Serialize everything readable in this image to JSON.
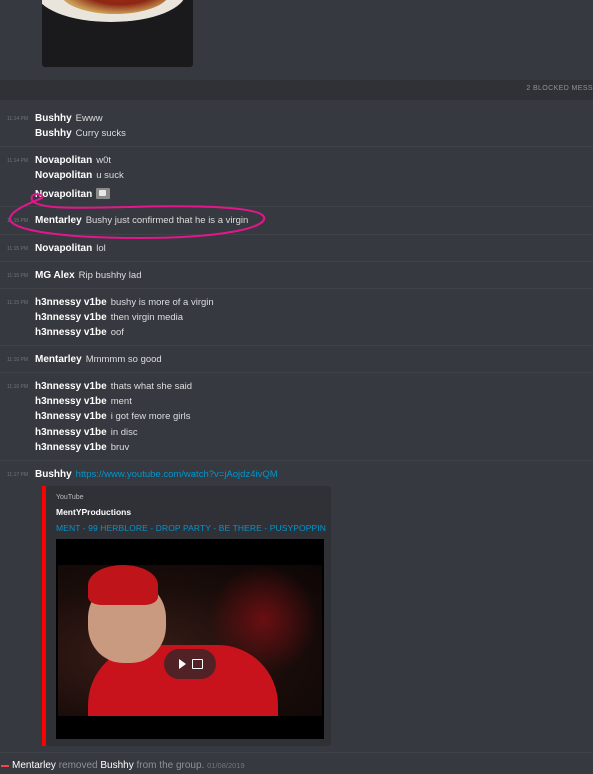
{
  "blocked_notice": "2 BLOCKED MESS",
  "messages": [
    {
      "time": "11:14 PM",
      "author": "Bushhy",
      "text": "Ewww"
    },
    {
      "time": "",
      "author": "Bushhy",
      "text": "Curry sucks"
    },
    {
      "time": "11:14 PM",
      "author": "Novapolitan",
      "text": "w0t"
    },
    {
      "time": "",
      "author": "Novapolitan",
      "text": "u suck"
    },
    {
      "time": "",
      "author": "Novapolitan",
      "text": ""
    },
    {
      "time": "11:15 PM",
      "author": "Mentarley",
      "text": "Bushy just confirmed that he is a virgin"
    },
    {
      "time": "11:15 PM",
      "author": "Novapolitan",
      "text": "lol"
    },
    {
      "time": "11:15 PM",
      "author": "MG Alex",
      "text": "Rip bushhy lad"
    },
    {
      "time": "11:15 PM",
      "author": "h3nnessy v1be",
      "text": "bushy is more of a virgin"
    },
    {
      "time": "",
      "author": "h3nnessy v1be",
      "text": "then virgin media"
    },
    {
      "time": "",
      "author": "h3nnessy v1be",
      "text": "oof"
    },
    {
      "time": "11:16 PM",
      "author": "Mentarley",
      "text": "Mmmmm so good"
    },
    {
      "time": "11:16 PM",
      "author": "h3nnessy v1be",
      "text": "thats what she said"
    },
    {
      "time": "",
      "author": "h3nnessy v1be",
      "text": "ment"
    },
    {
      "time": "",
      "author": "h3nnessy v1be",
      "text": "i got few more girls"
    },
    {
      "time": "",
      "author": "h3nnessy v1be",
      "text": "in disc"
    },
    {
      "time": "",
      "author": "h3nnessy v1be",
      "text": "bruv"
    },
    {
      "time": "11:17 PM",
      "author": "Bushhy",
      "link": "https://www.youtube.com/watch?v=jAojdz4ivQM"
    }
  ],
  "embed": {
    "provider": "YouTube",
    "author": "MentYProductions",
    "title": "MENT - 99 HERBLORE - DROP PARTY - BE THERE - PUSYPOPPIN"
  },
  "system": {
    "actor": "Mentarley",
    "action": "removed",
    "target": "Bushhy",
    "suffix": "from the group.",
    "date": "01/08/2019"
  },
  "icons": {
    "image_icon": "image-icon",
    "play": "play-icon",
    "external": "external-link-icon"
  },
  "colors": {
    "background": "#36393f",
    "link": "#0096cf",
    "youtube_border": "#ff0000",
    "annotation": "#e4168c",
    "leave_arrow": "#f04747"
  }
}
